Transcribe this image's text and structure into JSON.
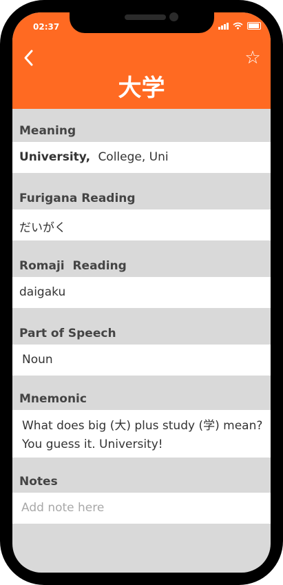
{
  "status_bar": {
    "time": "02:37"
  },
  "header": {
    "title": "大学",
    "back_icon": "chevron-left-icon",
    "favorite_icon": "star-outline-icon"
  },
  "sections": {
    "meaning": {
      "label": "Meaning",
      "primary": "University,",
      "secondary": "College, Uni"
    },
    "furigana": {
      "label": "Furigana Reading",
      "value": "だいがく"
    },
    "romaji": {
      "label": "Romaji  Reading",
      "value": "daigaku"
    },
    "pos": {
      "label": "Part of Speech",
      "value": "Noun"
    },
    "mnemonic": {
      "label": "Mnemonic",
      "value": "What does big (大) plus study (学) mean? You guess it. University!"
    },
    "notes": {
      "label": "Notes",
      "placeholder": "Add note here"
    }
  },
  "colors": {
    "accent": "#ff6a22",
    "section_bg": "#d9d9d9",
    "frame": "#000000"
  }
}
